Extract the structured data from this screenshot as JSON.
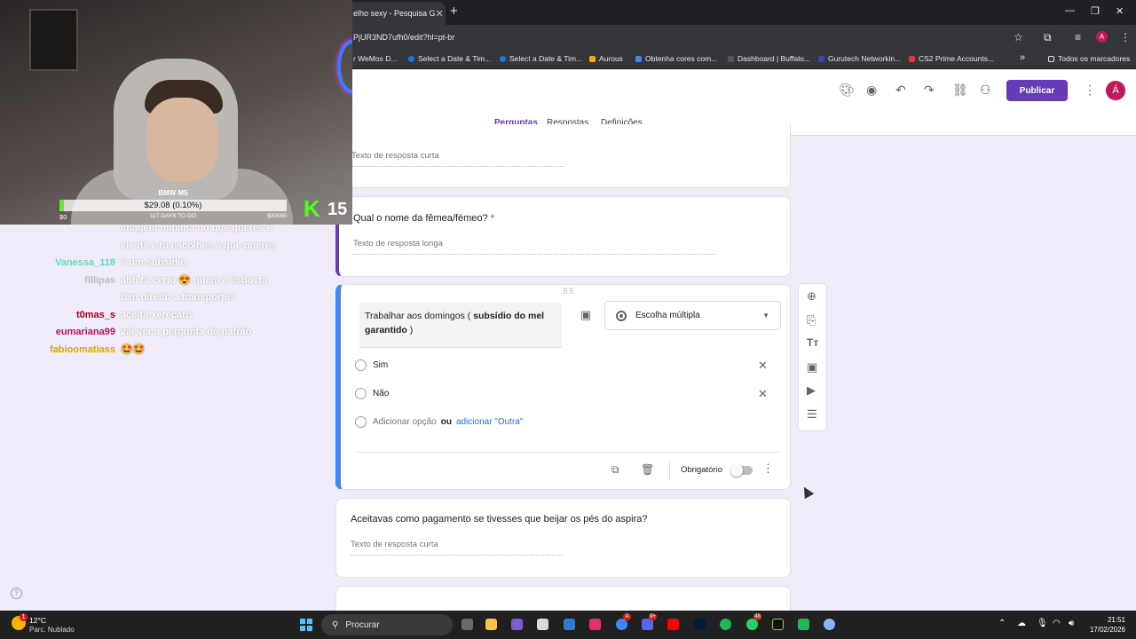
{
  "browser": {
    "tab_title": "elho sexy - Pesquisa G",
    "tab_close": "✕",
    "new_tab": "+",
    "url": "PjUR3ND7ufh0/edit?hl=pt-br",
    "bookmarks": [
      {
        "label": "r WeMos D...",
        "color": "#00979d"
      },
      {
        "label": "Select a Date & Tim...",
        "color": "#1a73e8"
      },
      {
        "label": "Select a Date & Tim...",
        "color": "#1a73e8"
      },
      {
        "label": "Aurous",
        "color": "#f9ab00"
      },
      {
        "label": "Obtenha cores com...",
        "color": "#4285f4"
      },
      {
        "label": "Dashboard | Buffalo...",
        "color": "#555555"
      },
      {
        "label": "Gurutech Networkin...",
        "color": "#3949ab"
      },
      {
        "label": "CS2 Prime Accounts...",
        "color": "#e53935"
      }
    ],
    "bookmarks_more": "»",
    "all_bookmarks": "Todos os marcadores",
    "profile_initial": "A"
  },
  "forms": {
    "publish_label": "Publicar",
    "avatar_initial": "Á",
    "tabs": {
      "questions": "Perguntas",
      "responses": "Respostas",
      "settings": "Definições"
    },
    "card_top": {
      "answer_placeholder": "Texto de resposta curta"
    },
    "card_female": {
      "question": "Qual o nome da fêmea/fémeo?",
      "required_mark": "*",
      "answer_placeholder": "Texto de resposta longa"
    },
    "card_active": {
      "question_plain": "Trabalhar aos domingos ( ",
      "question_bold": "subsídio do mel garantido",
      "question_end": " )",
      "type_label": "Escolha múltipla",
      "options": [
        "Sim",
        "Não"
      ],
      "add_option": "Adicionar opção",
      "or": "ou",
      "add_other": "adicionar \"Outra\"",
      "required_label": "Obrigatório",
      "required": false
    },
    "card_payment": {
      "question": "Aceitavas como pagamento se tivesses que beijar os pés do aspira?",
      "answer_placeholder": "Texto de resposta curta"
    }
  },
  "stream": {
    "goal": {
      "title": "BMW M5",
      "amount": "$29.08 (0.10%)",
      "progress": 0.001,
      "min": "$0",
      "days": "117 DAYS TO GO",
      "max": "$30000"
    },
    "viewers": "15",
    "chat": [
      {
        "user": "",
        "msg": "imagem mínima do que queres e",
        "color": "#ffffff"
      },
      {
        "user": "",
        "msg": "ele dá e tu escolhes a que queres",
        "color": "#ffffff"
      },
      {
        "user": "Vanessa_118",
        "msg": "é um subsídio",
        "color": "#66d9b8"
      },
      {
        "user": "fillipas",
        "msg": "ahh tá certo 😍 quem é lisboeta",
        "color": "#bdbdbd"
      },
      {
        "user": "",
        "msg": "tem direito a transporte?",
        "color": "#ffffff"
      },
      {
        "user": "t0mas_s",
        "msg": "aceita xerecard",
        "color": "#b00020"
      },
      {
        "user": "eumariana99",
        "msg": "vai ver a pergunta do patrão",
        "color": "#c2185b"
      },
      {
        "user": "fabioomatiass",
        "msg": "🤩🤩",
        "color": "#e6a300"
      }
    ]
  },
  "taskbar": {
    "weather_temp": "12°C",
    "weather_desc": "Parc. Nublado",
    "weather_badge": "1",
    "search_placeholder": "Procurar",
    "time": "21:51",
    "date": "17/02/2026",
    "badges": {
      "chrome": "A",
      "discord": "9+",
      "whatsapp": "48"
    }
  }
}
